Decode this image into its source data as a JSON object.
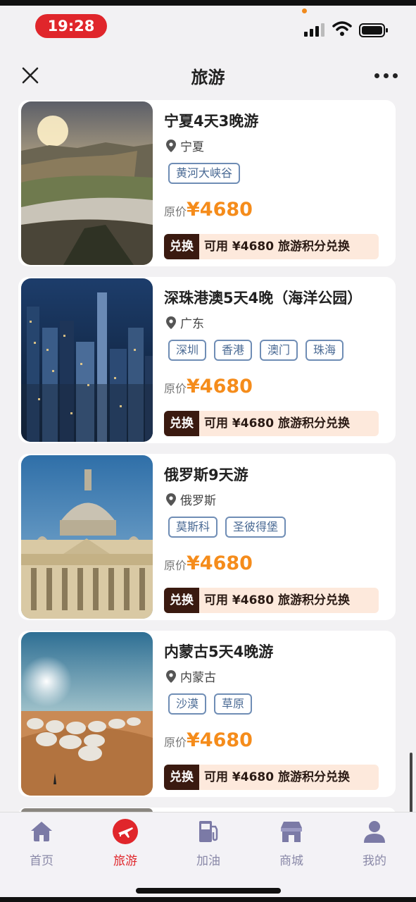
{
  "status_bar": {
    "time": "19:28",
    "icons": [
      "signal-icon",
      "wifi-icon",
      "battery-icon"
    ]
  },
  "nav": {
    "title": "旅游",
    "close_icon": "close-icon",
    "more_icon": "more-icon"
  },
  "cards": [
    {
      "title": "宁夏4天3晚游",
      "location": "宁夏",
      "tags": [
        "黄河大峡谷"
      ],
      "price_label": "原价",
      "price": "¥4680",
      "redeem_label": "兑换",
      "redeem_text": "可用 ¥4680 旅游积分兑换"
    },
    {
      "title": "深珠港澳5天4晚（海洋公园）",
      "location": "广东",
      "tags": [
        "深圳",
        "香港",
        "澳门",
        "珠海"
      ],
      "price_label": "原价",
      "price": "¥4680",
      "redeem_label": "兑换",
      "redeem_text": "可用 ¥4680 旅游积分兑换"
    },
    {
      "title": "俄罗斯9天游",
      "location": "俄罗斯",
      "tags": [
        "莫斯科",
        "圣彼得堡"
      ],
      "price_label": "原价",
      "price": "¥4680",
      "redeem_label": "兑换",
      "redeem_text": "可用 ¥4680 旅游积分兑换"
    },
    {
      "title": "内蒙古5天4晚游",
      "location": "内蒙古",
      "tags": [
        "沙漠",
        "草原"
      ],
      "price_label": "原价",
      "price": "¥4680",
      "redeem_label": "兑换",
      "redeem_text": "可用 ¥4680 旅游积分兑换"
    }
  ],
  "tabbar": {
    "items": [
      {
        "label": "首页",
        "icon": "home-icon"
      },
      {
        "label": "旅游",
        "icon": "plane-icon",
        "active": true
      },
      {
        "label": "加油",
        "icon": "fuel-icon"
      },
      {
        "label": "商城",
        "icon": "store-icon"
      },
      {
        "label": "我的",
        "icon": "user-icon"
      }
    ]
  },
  "colors": {
    "accent_red": "#e0262b",
    "price_orange": "#f58c1b",
    "tag_blue": "#4a6a94",
    "redeem_bg": "#fde9dc",
    "redeem_btn": "#3a1a10",
    "tab_inactive": "#8a89a8"
  }
}
